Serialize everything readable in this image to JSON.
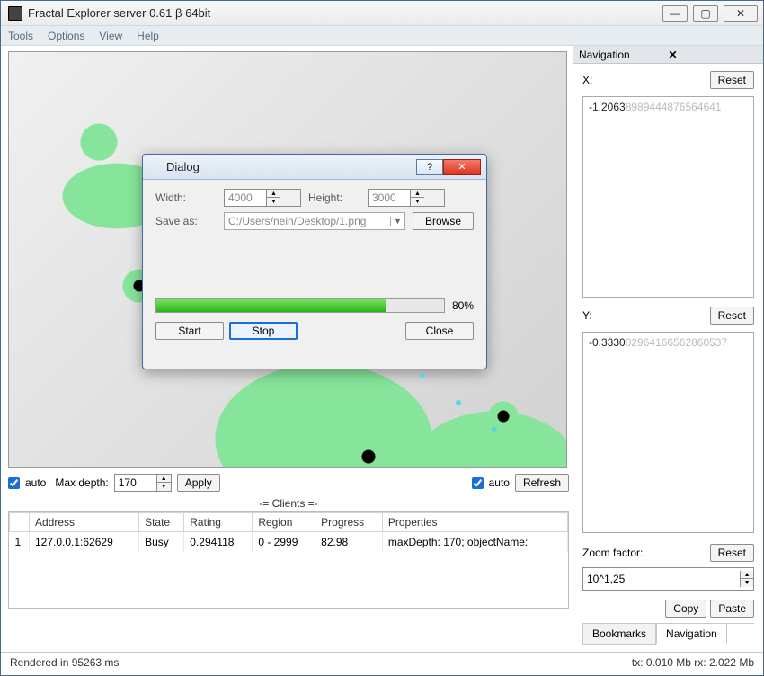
{
  "window": {
    "title": "Fractal Explorer server  0.61 β 64bit"
  },
  "menu": {
    "tools": "Tools",
    "options": "Options",
    "view": "View",
    "help": "Help"
  },
  "depth_panel": {
    "auto1_checked": true,
    "auto1_label": "auto",
    "max_depth_label": "Max depth:",
    "max_depth_value": "170",
    "apply": "Apply",
    "auto2_checked": true,
    "auto2_label": "auto",
    "refresh": "Refresh"
  },
  "clients": {
    "header": "-= Clients =-",
    "columns": [
      "",
      "Address",
      "State",
      "Rating",
      "Region",
      "Progress",
      "Properties"
    ],
    "rows": [
      {
        "idx": "1",
        "address": "127.0.0.1:62629",
        "state": "Busy",
        "rating": "0.294118",
        "region": "0 - 2999",
        "progress": "82.98",
        "properties": "maxDepth: 170; objectName:"
      }
    ]
  },
  "navigation": {
    "title": "Navigation",
    "x_label": "X:",
    "x_major": "-1.2063",
    "x_minor": "8989444876564641",
    "y_label": "Y:",
    "y_major": "-0.3330",
    "y_minor": "0296416656286053​7",
    "reset": "Reset",
    "zoom_label": "Zoom factor:",
    "zoom_value": "10^1,25",
    "copy": "Copy",
    "paste": "Paste",
    "tab_bookmarks": "Bookmarks",
    "tab_navigation": "Navigation"
  },
  "status": {
    "left": "Rendered in 95263 ms",
    "right": "tx: 0.010 Mb rx: 2.022 Mb"
  },
  "dialog": {
    "title": "Dialog",
    "width_label": "Width:",
    "width_value": "4000",
    "height_label": "Height:",
    "height_value": "3000",
    "save_as_label": "Save as:",
    "save_as_value": "C:/Users/nein/Desktop/1.png",
    "browse": "Browse",
    "progress_pct": "80%",
    "progress_width": "80%",
    "start": "Start",
    "stop": "Stop",
    "close": "Close"
  }
}
